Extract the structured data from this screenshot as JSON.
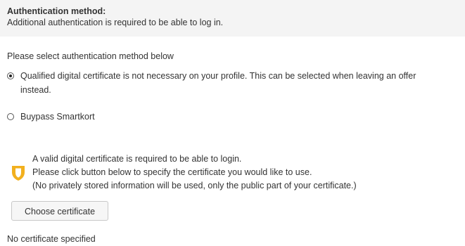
{
  "header": {
    "title": "Authentication method:",
    "subtitle": "Additional authentication is required to be able to log in."
  },
  "instructions": "Please select authentication method below",
  "options": [
    {
      "line1": "Qualified digital certificate is not necessary on your profile. This can be selected when leaving an offer",
      "line2": "instead.",
      "selected": true
    },
    {
      "label": "Buypass Smartkort",
      "selected": false
    }
  ],
  "certificate_info": {
    "icon": "shield-icon",
    "color": "#f2b01e",
    "lines": [
      "A valid digital certificate is required to be able to login.",
      "Please click button below to specify the certificate you would like to use.",
      "(No privately stored information will be used, only the public part of your certificate.)"
    ]
  },
  "choose_button_label": "Choose certificate",
  "status": "No certificate specified"
}
